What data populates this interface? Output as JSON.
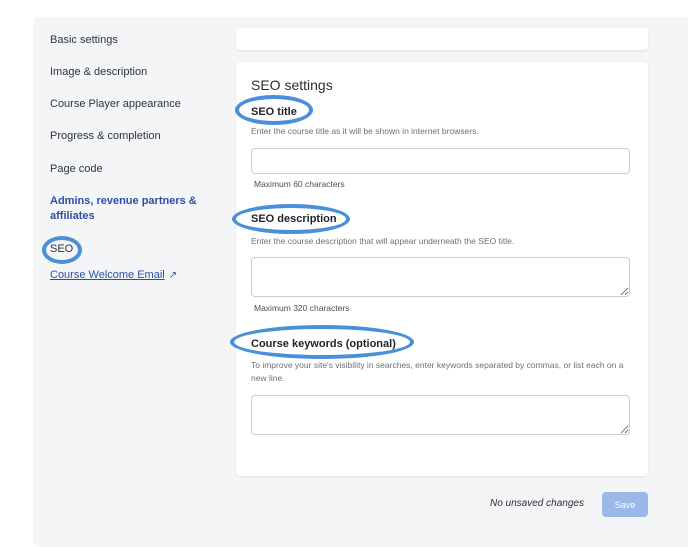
{
  "sidebar": {
    "items": [
      {
        "label": "Basic settings"
      },
      {
        "label": "Image & description"
      },
      {
        "label": "Course Player appearance"
      },
      {
        "label": "Progress & completion"
      },
      {
        "label": "Page code"
      },
      {
        "label": "Admins, revenue partners & affiliates"
      },
      {
        "label": "SEO"
      },
      {
        "label": "Course Welcome Email"
      }
    ],
    "external_icon": "↗"
  },
  "seo": {
    "title": "SEO settings",
    "seo_title": {
      "label": "SEO title",
      "help": "Enter the course title as it will be shown in internet browsers.",
      "value": "",
      "hint": "Maximum 60 characters"
    },
    "seo_description": {
      "label": "SEO description",
      "help": "Enter the course description that will appear underneath the SEO title.",
      "value": "",
      "hint": "Maximum 320 characters"
    },
    "keywords": {
      "label": "Course keywords (optional)",
      "help": "To improve your site's visibility in searches, enter keywords separated by commas, or list each on a new line.",
      "value": ""
    }
  },
  "footer": {
    "status": "No unsaved changes",
    "save_label": "Save"
  },
  "colors": {
    "highlight": "#4a90d9",
    "link": "#2b4fa8",
    "save_disabled": "#9cb8e8"
  }
}
